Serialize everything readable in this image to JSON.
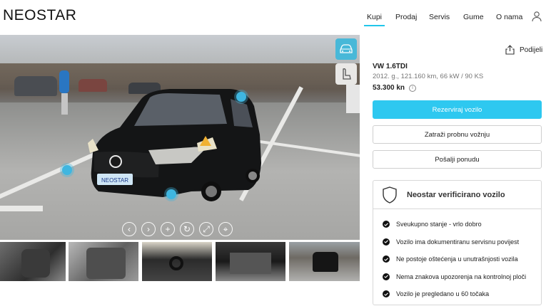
{
  "brand": {
    "logo": "NEOSTAR",
    "plate_text": "NEOSTAR"
  },
  "nav": {
    "items": [
      {
        "label": "Kupi",
        "active": true
      },
      {
        "label": "Prodaj",
        "active": false
      },
      {
        "label": "Servis",
        "active": false
      },
      {
        "label": "Gume",
        "active": false
      },
      {
        "label": "O nama",
        "active": false
      }
    ],
    "user_icon": "user-icon"
  },
  "gallery": {
    "view_buttons": [
      "car-exterior-icon",
      "car-seat-icon"
    ],
    "controls": [
      "chevron-left-icon",
      "chevron-right-icon",
      "plus-icon",
      "rotate-icon",
      "expand-icon",
      "location-icon"
    ],
    "thumbnails": [
      "interior-front-seats",
      "rear-seats",
      "dashboard",
      "trunk",
      "car-front-exterior"
    ]
  },
  "listing": {
    "share_label": "Podijeli",
    "title": "VW 1.6TDI",
    "specs": "2012. g., 121.160 km, 66 kW / 90 KS",
    "price": "53.300 kn"
  },
  "actions": {
    "reserve": "Rezerviraj vozilo",
    "test_drive": "Zatraži probnu vožnju",
    "offer": "Pošalji ponudu"
  },
  "verified": {
    "title": "Neostar verificirano vozilo",
    "items": [
      "Sveukupno stanje - vrlo dobro",
      "Vozilo ima dokumentiranu servisnu povijest",
      "Ne postoje oštećenja u unutrašnjosti vozila",
      "Nema znakova upozorenja na kontrolnoj ploči",
      "Vozilo je pregledano u 60 točaka"
    ]
  },
  "colors": {
    "accent": "#2ec8f0",
    "text": "#1a1a1a",
    "muted": "#777777"
  }
}
